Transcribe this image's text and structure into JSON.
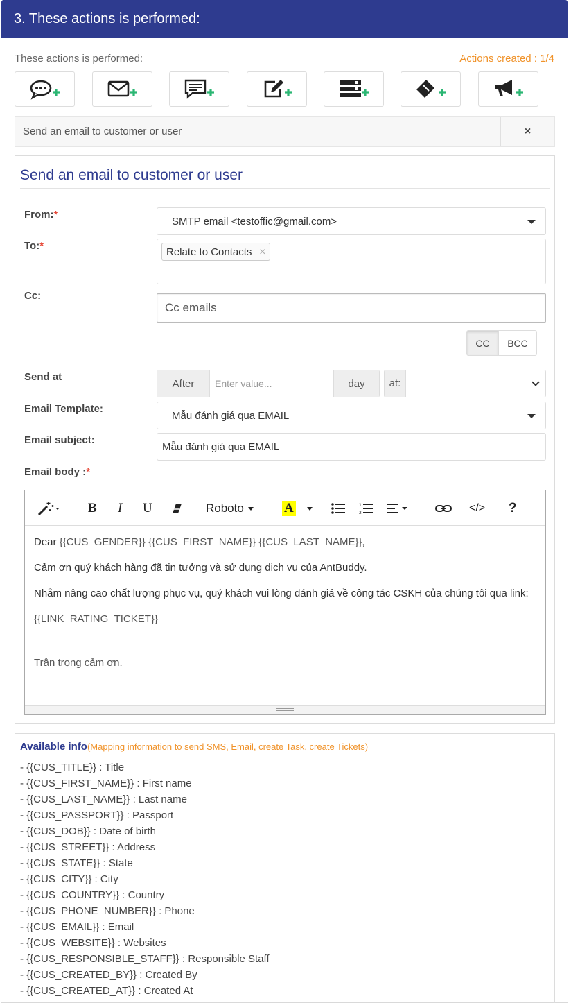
{
  "header": {
    "title": "3. These actions is performed:"
  },
  "actions": {
    "label": "These actions is performed:",
    "count": "Actions created : 1/4",
    "buttons": [
      "add-chat",
      "add-email",
      "add-sms",
      "add-note",
      "add-task",
      "add-ticket",
      "add-campaign"
    ]
  },
  "current_action": {
    "label": "Send an email to customer or user",
    "close": "×"
  },
  "form": {
    "title": "Send an email to customer or user",
    "from_label": "From:",
    "from_value": "SMTP email <testoffic@gmail.com>",
    "to_label": "To:",
    "to_tag": "Relate to Contacts",
    "tag_remove": "×",
    "cc_label": "Cc:",
    "cc_placeholder": "Cc emails",
    "cc_button": "CC",
    "bcc_button": "BCC",
    "send_at_label": "Send at",
    "after": "After",
    "value_placeholder": "Enter value...",
    "unit": "day",
    "at": "at:",
    "template_label": "Email Template:",
    "template_value": "Mẫu đánh giá qua EMAIL",
    "subject_label": "Email subject:",
    "subject_value": "Mẫu đánh giá qua EMAIL",
    "body_label": "Email body :",
    "required_mark": "*"
  },
  "editor": {
    "font": "Roboto",
    "help": "?",
    "code": "</>",
    "body": {
      "greeting_prefix": "Dear ",
      "greeting_vars": "{{CUS_GENDER}}  {{CUS_FIRST_NAME}} {{CUS_LAST_NAME}},",
      "line1": "Cảm ơn quý khách hàng đã tin tưởng và sử dụng dich vụ của AntBuddy.",
      "line2": "Nhằm nâng cao chất lượng phục vụ, quý khách vui lòng đánh giá về công tác CSKH của chúng tôi qua link:",
      "link": "{{LINK_RATING_TICKET}}",
      "closing": "Trân trọng cảm ơn."
    }
  },
  "info": {
    "title": "Available info",
    "note": "(Mapping information to send SMS, Email, create Task, create Tickets)",
    "items": [
      "- {{CUS_TITLE}} : Title",
      "- {{CUS_FIRST_NAME}} : First name",
      "- {{CUS_LAST_NAME}} : Last name",
      "- {{CUS_PASSPORT}} : Passport",
      "- {{CUS_DOB}} : Date of birth",
      "- {{CUS_STREET}} : Address",
      "- {{CUS_STATE}} : State",
      "- {{CUS_CITY}} : City",
      "- {{CUS_COUNTRY}} : Country",
      "- {{CUS_PHONE_NUMBER}} : Phone",
      "- {{CUS_EMAIL}} : Email",
      "- {{CUS_WEBSITE}} : Websites",
      "- {{CUS_RESPONSIBLE_STAFF}} : Responsible Staff",
      "- {{CUS_CREATED_BY}} : Created By",
      "- {{CUS_CREATED_AT}} : Created At"
    ]
  },
  "colors": {
    "header": "#2e3b8f",
    "accent": "#f0932b",
    "plus": "#2bb673",
    "required": "#e74c3c"
  }
}
